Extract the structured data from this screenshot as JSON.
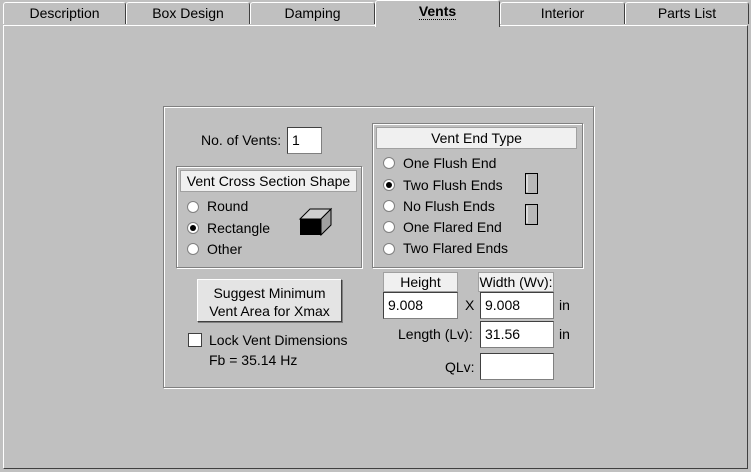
{
  "tabs": [
    {
      "label": "Description"
    },
    {
      "label": "Box Design"
    },
    {
      "label": "Damping"
    },
    {
      "label": "Vents"
    },
    {
      "label": "Interior"
    },
    {
      "label": "Parts List"
    }
  ],
  "active_tab": "Vents",
  "vents": {
    "count_label": "No. of Vents:",
    "count_value": "1",
    "cross_section": {
      "header": "Vent Cross Section Shape",
      "options": [
        "Round",
        "Rectangle",
        "Other"
      ],
      "selected": "Rectangle"
    },
    "end_type": {
      "header": "Vent End Type",
      "options": [
        "One Flush End",
        "Two Flush Ends",
        "No Flush Ends",
        "One Flared End",
        "Two Flared Ends"
      ],
      "selected": "Two Flush Ends"
    },
    "suggest_button": {
      "line1": "Suggest Minimum",
      "line2": "Vent Area for Xmax"
    },
    "lock_label": "Lock Vent Dimensions",
    "lock_checked": false,
    "fb_text": "Fb = 35.14 Hz",
    "height_label": "Height (Hv):",
    "height_value": "9.008",
    "times_label": "X",
    "width_label": "Width (Wv):",
    "width_value": "9.008",
    "unit_in": "in",
    "length_label": "Length (Lv):",
    "length_value": "31.56",
    "qlv_label": "QLv:",
    "qlv_value": ""
  }
}
